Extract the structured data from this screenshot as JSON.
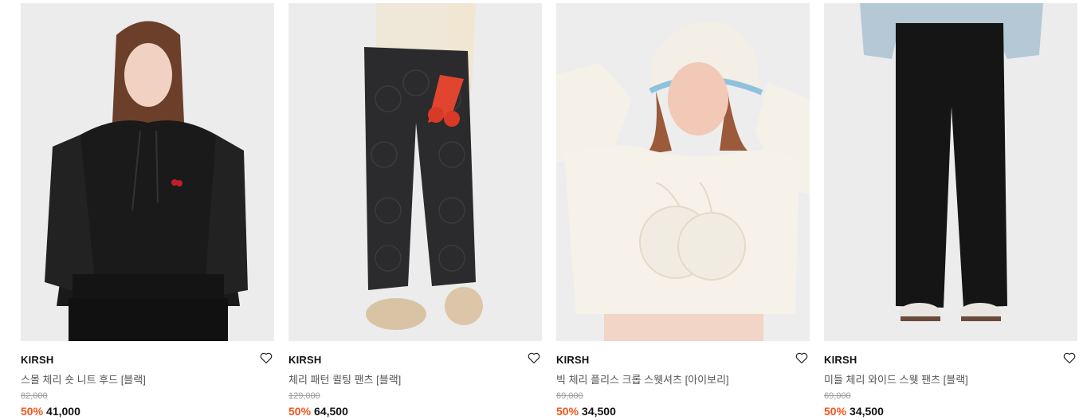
{
  "products": [
    {
      "brand": "KIRSH",
      "name": "스몰 체리 숏 니트 후드 [블랙]",
      "original_price": "82,000",
      "discount": "50%",
      "price": "41,000"
    },
    {
      "brand": "KIRSH",
      "name": "체리 패턴 퀼팅 팬츠 [블랙]",
      "original_price": "129,000",
      "discount": "50%",
      "price": "64,500"
    },
    {
      "brand": "KIRSH",
      "name": "빅 체리 플리스 크롭 스웻셔츠 [아이보리]",
      "original_price": "69,000",
      "discount": "50%",
      "price": "34,500"
    },
    {
      "brand": "KIRSH",
      "name": "미들 체리 와이드 스웻 팬츠 [블랙]",
      "original_price": "69,000",
      "discount": "50%",
      "price": "34,500"
    }
  ],
  "colors": {
    "discount": "#f2541b",
    "price": "#111111",
    "original_price": "#9a9a9a",
    "photo_bg": "#ededee"
  },
  "icons": {
    "wishlist": "heart-outline-icon"
  }
}
